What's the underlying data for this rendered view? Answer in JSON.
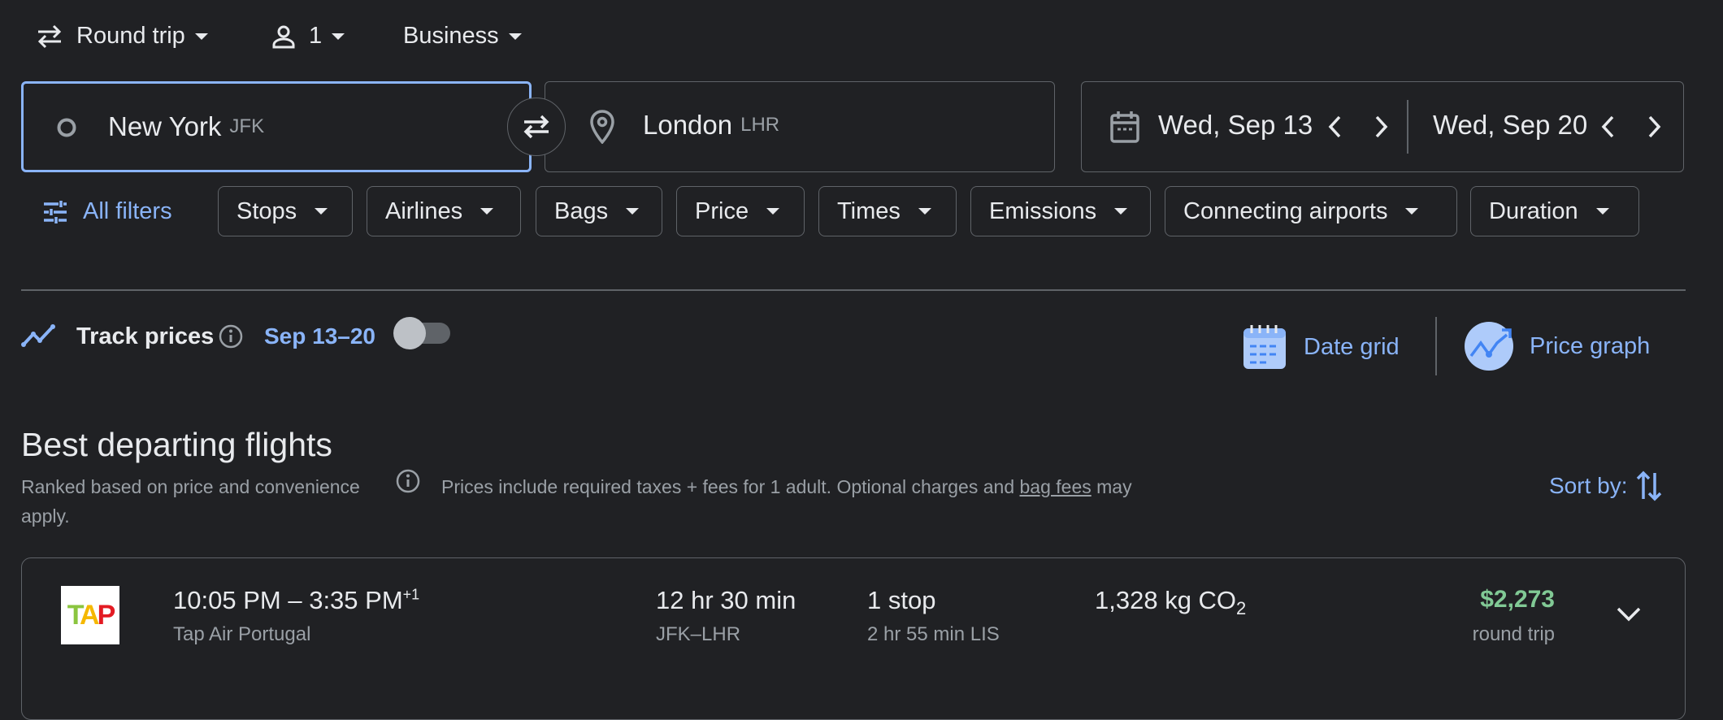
{
  "trip": {
    "type": "Round trip",
    "passengers": "1",
    "cabin": "Business"
  },
  "origin": {
    "city": "New York",
    "code": "JFK"
  },
  "destination": {
    "city": "London",
    "code": "LHR"
  },
  "dates": {
    "depart": "Wed, Sep 13",
    "return": "Wed, Sep 20"
  },
  "filters": {
    "all_filters": "All filters",
    "chips": [
      "Stops",
      "Airlines",
      "Bags",
      "Price",
      "Times",
      "Emissions",
      "Connecting airports",
      "Duration"
    ]
  },
  "track": {
    "label": "Track prices",
    "range": "Sep 13–20",
    "enabled": false
  },
  "views": {
    "date_grid": "Date grid",
    "price_graph": "Price graph"
  },
  "results": {
    "heading": "Best departing flights",
    "ranked": "Ranked based on price and convenience",
    "note_before": "Prices include required taxes + fees for 1 adult. Optional charges and",
    "bag_fees": "bag fees",
    "note_after": "may",
    "note_wrap": "apply.",
    "sort_label": "Sort by:"
  },
  "flights": [
    {
      "logo_text": "TAP",
      "depart": "10:05 PM",
      "separator": "–",
      "arrive": "3:35 PM",
      "day_offset": "+1",
      "airline": "Tap Air Portugal",
      "duration": "12 hr 30 min",
      "route": "JFK–LHR",
      "stops": "1 stop",
      "layover": "2 hr 55 min LIS",
      "emissions_value": "1,328 kg CO",
      "emissions_sub": "2",
      "price": "$2,273",
      "price_note": "round trip"
    }
  ],
  "colors": {
    "accent": "#8ab4f8",
    "price_green": "#81c995",
    "background": "#202124",
    "border": "#5f6368"
  }
}
